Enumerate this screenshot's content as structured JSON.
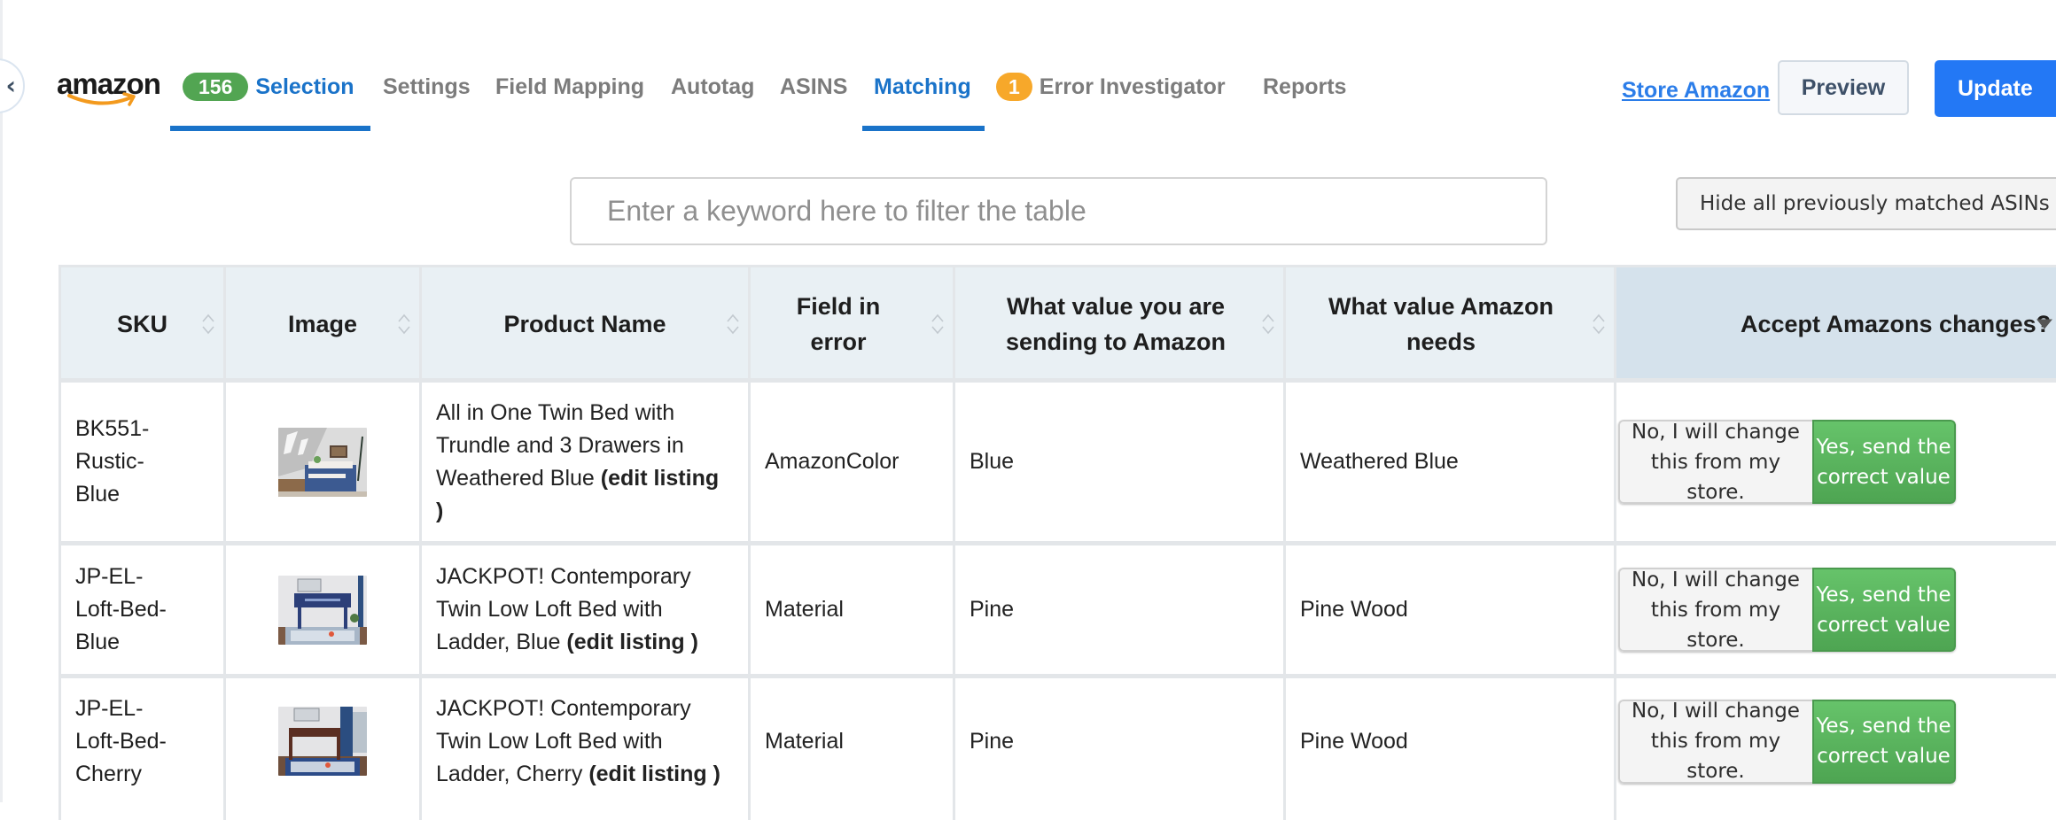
{
  "brand": {
    "logo_text": "amazon"
  },
  "nav": {
    "tabs": [
      {
        "label": "Selection",
        "badge": "156",
        "badge_color": "#52a552",
        "active": true
      },
      {
        "label": "Settings"
      },
      {
        "label": "Field Mapping"
      },
      {
        "label": "Autotag"
      },
      {
        "label": "ASINS"
      },
      {
        "label": "Matching",
        "active": true
      },
      {
        "label": "Error Investigator",
        "badge": "1",
        "badge_color": "#f7a82a"
      },
      {
        "label": "Reports"
      }
    ],
    "store_link": "Store Amazon",
    "preview_label": "Preview",
    "update_label": "Update"
  },
  "filter": {
    "placeholder": "Enter a keyword here to filter the table",
    "value": "",
    "hide_matched_label": "Hide all previously matched ASINs"
  },
  "table": {
    "columns": [
      {
        "label": "SKU",
        "sortable": true
      },
      {
        "label": "Image",
        "sortable": true
      },
      {
        "label": "Product Name",
        "sortable": true
      },
      {
        "label": "Field in error",
        "sortable": true
      },
      {
        "label": "What value you are sending to Amazon",
        "sortable": true
      },
      {
        "label": "What value Amazon needs",
        "sortable": true
      },
      {
        "label": "Accept Amazons changes?",
        "filter_dropdown": true
      }
    ],
    "edit_link_label": "edit listing",
    "rows": [
      {
        "sku": "BK551-Rustic-Blue",
        "image": "bed-trundle-blue-thumbnail",
        "product_name": "All in One Twin Bed with Trundle and 3 Drawers in Weathered Blue",
        "field_in_error": "AmazonColor",
        "sending_value": "Blue",
        "amazon_value": "Weathered Blue",
        "no_label": "No, I will change this from my store.",
        "yes_label": "Yes, send the correct value",
        "selected": "yes"
      },
      {
        "sku": "JP-EL-Loft-Bed-Blue",
        "image": "loft-bed-blue-thumbnail",
        "product_name": "JACKPOT! Contemporary Twin Low Loft Bed with Ladder, Blue",
        "field_in_error": "Material",
        "sending_value": "Pine",
        "amazon_value": "Pine Wood",
        "no_label": "No, I will change this from my store.",
        "yes_label": "Yes, send the correct value",
        "selected": "yes"
      },
      {
        "sku": "JP-EL-Loft-Bed-Cherry",
        "image": "loft-bed-cherry-thumbnail",
        "product_name": "JACKPOT! Contemporary Twin Low Loft Bed with Ladder, Cherry",
        "field_in_error": "Material",
        "sending_value": "Pine",
        "amazon_value": "Pine Wood",
        "no_label": "No, I will change this from my store.",
        "yes_label": "Yes, send the correct value",
        "selected": "yes"
      }
    ]
  }
}
